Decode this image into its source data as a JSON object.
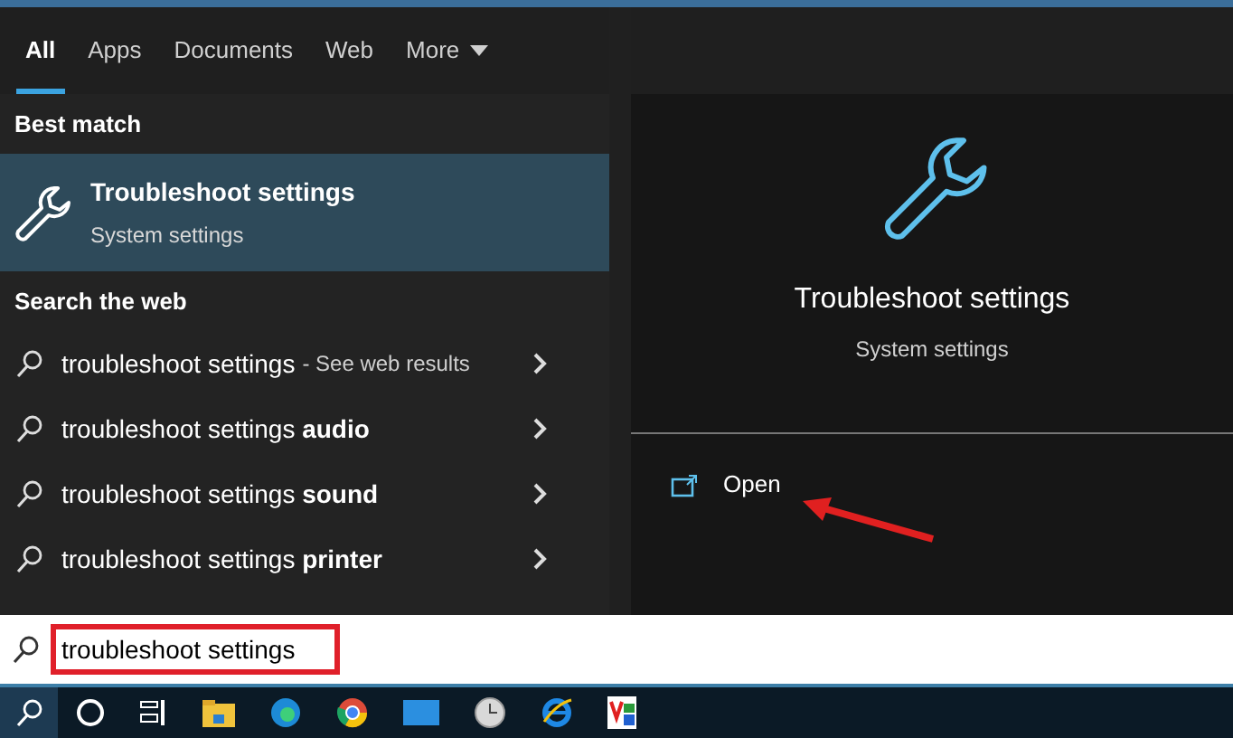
{
  "tabs": [
    {
      "label": "All",
      "selected": true,
      "has_menu": false
    },
    {
      "label": "Apps",
      "selected": false,
      "has_menu": false
    },
    {
      "label": "Documents",
      "selected": false,
      "has_menu": false
    },
    {
      "label": "Web",
      "selected": false,
      "has_menu": false
    },
    {
      "label": "More",
      "selected": false,
      "has_menu": true
    }
  ],
  "best_match": {
    "heading": "Best match",
    "title": "Troubleshoot settings",
    "subtitle": "System settings",
    "selected": true
  },
  "web": {
    "heading": "Search the web",
    "items": [
      {
        "text": "troubleshoot settings",
        "note": "- See web results"
      },
      {
        "text": "troubleshoot settings **audio**"
      },
      {
        "text": "troubleshoot settings **sound**"
      },
      {
        "text": "troubleshoot settings **printer**"
      }
    ]
  },
  "preview": {
    "title": "Troubleshoot settings",
    "subtitle": "System settings",
    "actions": [
      {
        "label": "Open"
      }
    ]
  },
  "search": {
    "value": "troubleshoot settings"
  }
}
